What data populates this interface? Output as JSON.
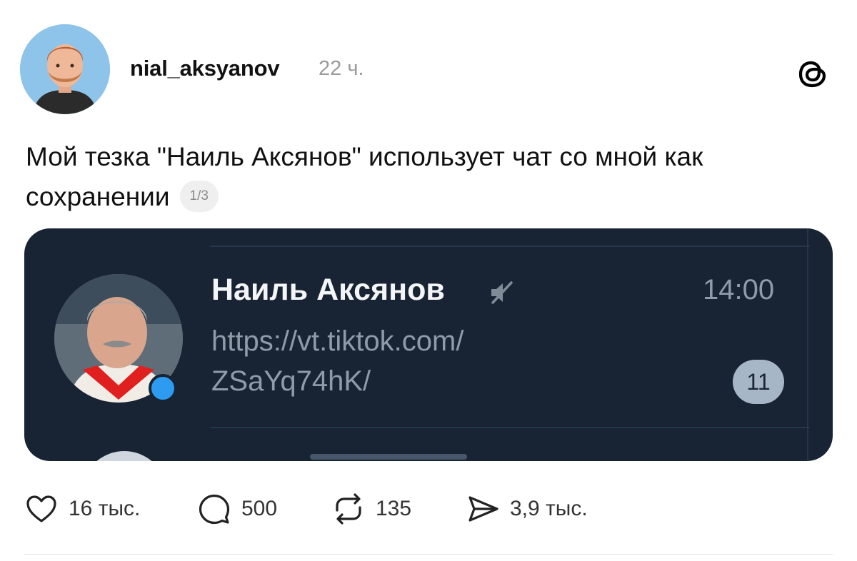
{
  "author": {
    "username": "nial_aksyanov",
    "time": "22 ч."
  },
  "post": {
    "text": "Мой тезка \"Наиль Аксянов\" использует чат со мной как сохранении",
    "pager": "1/3"
  },
  "media_card": {
    "chat_name": "Наиль Аксянов",
    "chat_time": "14:00",
    "preview_line1": "https://vt.tiktok.com/",
    "preview_line2": "ZSaYq74hK/",
    "unread_count": "11",
    "online_status_color": "#2d9cf0",
    "background_color": "#182433"
  },
  "actions": {
    "like_count": "16 тыс.",
    "reply_count": "500",
    "repost_count": "135",
    "share_count": "3,9 тыс."
  },
  "icons": {
    "like": "heart-icon",
    "reply": "comment-bubble-icon",
    "repost": "repost-icon",
    "share": "send-icon",
    "brand": "threads-logo-icon",
    "muted": "muted-speaker-icon"
  }
}
